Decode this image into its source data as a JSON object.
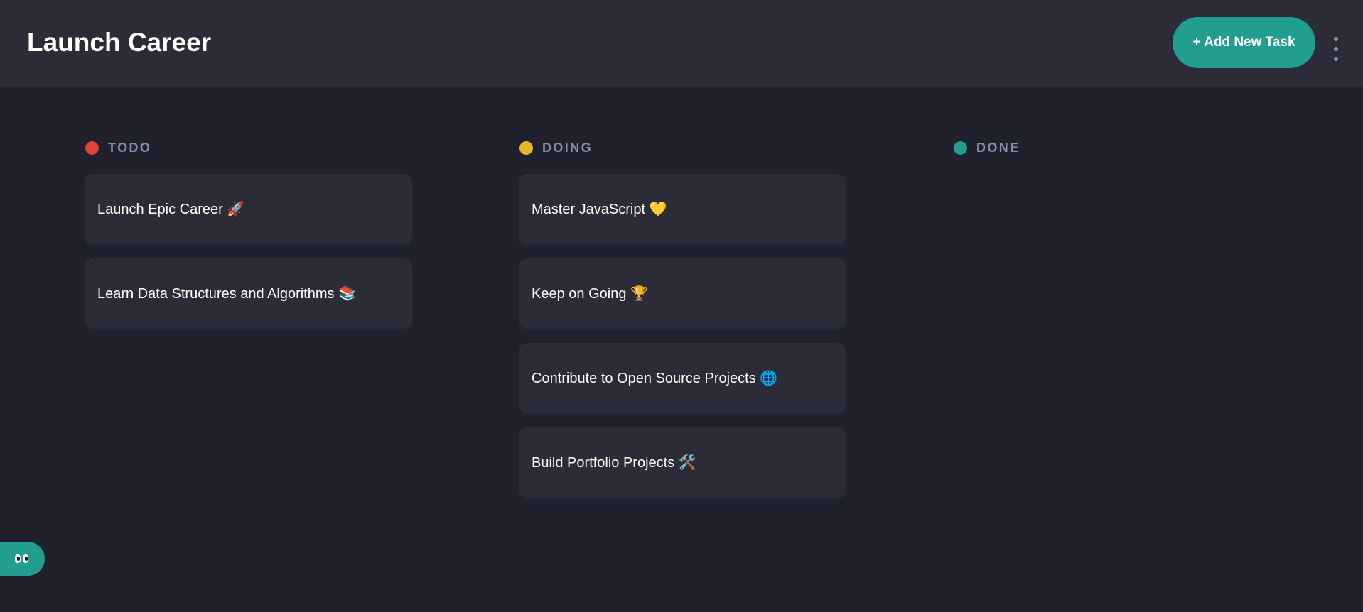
{
  "header": {
    "board_title": "Launch Career",
    "add_task_label": "+ Add New Task",
    "menu_icon": "vertical-ellipsis-icon"
  },
  "columns": [
    {
      "name": "TODO",
      "color": "#e0453a",
      "tasks": [
        {
          "title": "Launch Epic Career 🚀"
        },
        {
          "title": "Learn Data Structures and Algorithms 📚"
        }
      ]
    },
    {
      "name": "DOING",
      "color": "#eab52c",
      "tasks": [
        {
          "title": "Master JavaScript 💛"
        },
        {
          "title": "Keep on Going 🏆"
        },
        {
          "title": "Contribute to Open Source Projects 🌐"
        },
        {
          "title": "Build Portfolio Projects 🛠️"
        }
      ]
    },
    {
      "name": "DONE",
      "color": "#219e8e",
      "tasks": []
    }
  ],
  "colors": {
    "accent": "#219e8e",
    "background": "#21212d",
    "surface": "#2b2c37",
    "muted_text": "#828fa3"
  },
  "feedback_widget": {
    "icon": "eyes-icon"
  }
}
